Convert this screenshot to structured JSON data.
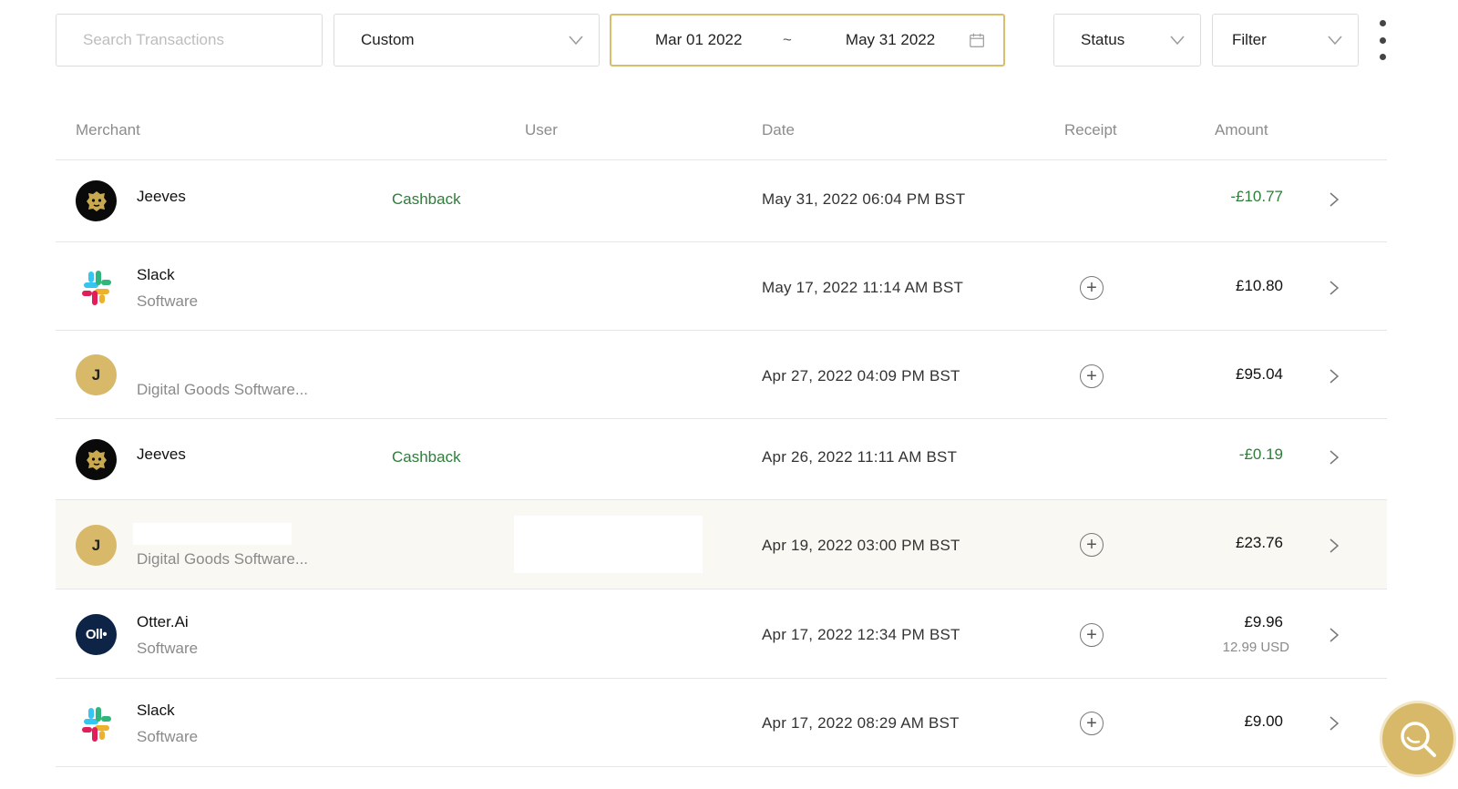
{
  "toolbar": {
    "search_placeholder": "Search Transactions",
    "period_value": "Custom",
    "date_from": "Mar 01 2022",
    "date_sep": "~",
    "date_to": "May 31 2022",
    "status_label": "Status",
    "filter_label": "Filter"
  },
  "columns": [
    "Merchant",
    "User",
    "Date",
    "Receipt",
    "Amount"
  ],
  "transactions": [
    {
      "merchant": "Jeeves",
      "category": "",
      "tag": "Cashback",
      "date": "May 31, 2022 06:04 PM BST",
      "amount": "-£10.77",
      "amount_sub": "",
      "icon": "jeeves-lion-logo"
    },
    {
      "merchant": "Slack",
      "category": "Software",
      "tag": "",
      "date": "May 17, 2022 11:14 AM BST",
      "amount": "£10.80",
      "amount_sub": "",
      "icon": "slack-logo"
    },
    {
      "merchant": "J",
      "category": "Digital Goods Software...",
      "tag": "",
      "date": "Apr 27, 2022 04:09 PM BST",
      "amount": "£95.04",
      "amount_sub": "",
      "icon": "initial-avatar"
    },
    {
      "merchant": "Jeeves",
      "category": "",
      "tag": "Cashback",
      "date": "Apr 26, 2022 11:11 AM BST",
      "amount": "-£0.19",
      "amount_sub": "",
      "icon": "jeeves-lion-logo"
    },
    {
      "merchant": "J",
      "category": "Digital Goods Software...",
      "tag": "",
      "date": "Apr 19, 2022 03:00 PM BST",
      "amount": "£23.76",
      "amount_sub": "",
      "icon": "initial-avatar"
    },
    {
      "merchant": "Otter.Ai",
      "category": "Software",
      "tag": "",
      "date": "Apr 17, 2022 12:34 PM BST",
      "amount": "£9.96",
      "amount_sub": "12.99 USD",
      "icon": "otter-logo",
      "logo_text": "Oll•"
    },
    {
      "merchant": "Slack",
      "category": "Software",
      "tag": "",
      "date": "Apr 17, 2022 08:29 AM BST",
      "amount": "£9.00",
      "amount_sub": "",
      "icon": "slack-logo"
    }
  ],
  "colors": {
    "accent_gold": "#d7b969",
    "positive_green": "#2e7d3a",
    "highlight_row": "#faf8f3"
  }
}
